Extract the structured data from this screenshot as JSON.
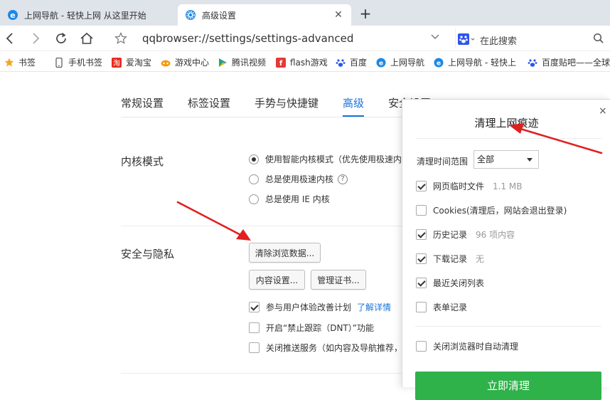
{
  "tabs": [
    {
      "title": "上网导航 - 轻快上网 从这里开始",
      "icon": "ie-e-icon",
      "active": false
    },
    {
      "title": "高级设置",
      "icon": "settings-gear-icon",
      "active": true
    }
  ],
  "new_tab_symbol": "+",
  "address": {
    "url": "qqbrowser://settings/settings-advanced",
    "search_placeholder": "在此搜索"
  },
  "bookmarks": [
    {
      "label": "书签",
      "icon": "star-icon"
    },
    {
      "label": "手机书签",
      "icon": "phone-icon"
    },
    {
      "label": "爱淘宝",
      "icon": "taobao-icon"
    },
    {
      "label": "游戏中心",
      "icon": "gamepad-icon"
    },
    {
      "label": "腾讯视频",
      "icon": "video-play-icon"
    },
    {
      "label": "flash游戏",
      "icon": "flash-icon"
    },
    {
      "label": "百度",
      "icon": "baidu-paw-icon"
    },
    {
      "label": "上网导航",
      "icon": "ie-e-icon"
    },
    {
      "label": "上网导航 - 轻快上",
      "icon": "ie-e-icon"
    },
    {
      "label": "百度贴吧——全球",
      "icon": "baidu-paw-icon"
    }
  ],
  "settings": {
    "tabs": [
      "常规设置",
      "标签设置",
      "手势与快捷键",
      "高级",
      "安全设置"
    ],
    "active_tab": "高级",
    "kernel": {
      "title": "内核模式",
      "options": [
        {
          "label": "使用智能内核模式（优先使用极速内核",
          "selected": true
        },
        {
          "label": "总是使用极速内核",
          "selected": false,
          "help": "?"
        },
        {
          "label": "总是使用 IE 内核",
          "selected": false
        }
      ]
    },
    "privacy": {
      "title": "安全与隐私",
      "clear_button": "清除浏览数据...",
      "content_button": "内容设置...",
      "cert_button": "管理证书...",
      "checks": [
        {
          "label": "参与用户体验改善计划",
          "checked": true,
          "link": "了解详情"
        },
        {
          "label": "开启“禁止跟踪（DNT）”功能",
          "checked": false
        },
        {
          "label": "关闭推送服务（如内容及导航推荐，",
          "checked": false
        }
      ]
    }
  },
  "dialog": {
    "title": "清理上网痕迹",
    "close": "×",
    "range_label": "清理时间范围",
    "range_value": "全部",
    "items": [
      {
        "label": "网页临时文件",
        "sub": "1.1 MB",
        "checked": true
      },
      {
        "label": "Cookies(清理后，网站会退出登录)",
        "sub": "",
        "checked": false
      },
      {
        "label": "历史记录",
        "sub": "96 项内容",
        "checked": true
      },
      {
        "label": "下载记录",
        "sub": "无",
        "checked": true
      },
      {
        "label": "最近关闭列表",
        "sub": "",
        "checked": true
      },
      {
        "label": "表单记录",
        "sub": "",
        "checked": false
      }
    ],
    "auto_clear": {
      "label": "关闭浏览器时自动清理",
      "checked": false
    },
    "action_button": "立即清理"
  },
  "colors": {
    "accent": "#1a73d9",
    "action_green": "#2eb249",
    "annotation_red": "#e02020"
  }
}
